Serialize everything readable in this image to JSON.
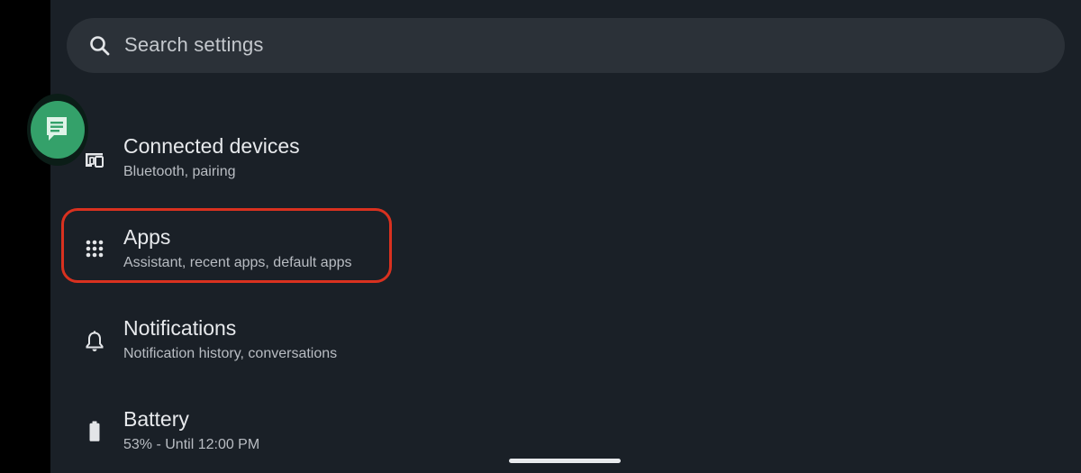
{
  "search": {
    "placeholder": "Search settings",
    "icon": "search-icon"
  },
  "floating_bubble": {
    "icon": "chat-bubble-icon",
    "color": "#34a16a"
  },
  "settings_items": [
    {
      "title": "Connected devices",
      "subtitle": "Bluetooth, pairing",
      "icon": "connected-devices-icon"
    },
    {
      "title": "Apps",
      "subtitle": "Assistant, recent apps, default apps",
      "icon": "apps-grid-icon",
      "highlighted": true
    },
    {
      "title": "Notifications",
      "subtitle": "Notification history, conversations",
      "icon": "bell-icon"
    },
    {
      "title": "Battery",
      "subtitle": "53% - Until 12:00 PM",
      "icon": "battery-icon"
    }
  ],
  "colors": {
    "background": "#1a2027",
    "search_bar": "#2b3138",
    "highlight": "#d9311f",
    "text_primary": "#e7e9ec",
    "text_secondary": "#b9bdc3"
  }
}
